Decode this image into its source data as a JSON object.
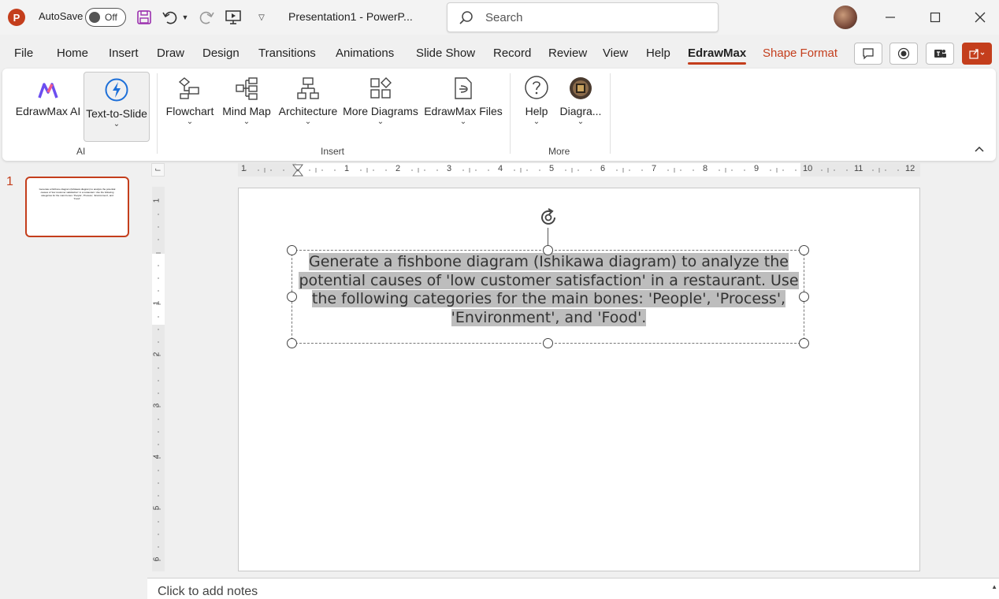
{
  "titlebar": {
    "autosave_label": "AutoSave",
    "autosave_state": "Off",
    "document_title": "Presentation1  -  PowerP...",
    "search_placeholder": "Search"
  },
  "tabs": [
    {
      "label": "File"
    },
    {
      "label": "Home"
    },
    {
      "label": "Insert"
    },
    {
      "label": "Draw"
    },
    {
      "label": "Design"
    },
    {
      "label": "Transitions"
    },
    {
      "label": "Animations"
    },
    {
      "label": "Slide Show"
    },
    {
      "label": "Record"
    },
    {
      "label": "Review"
    },
    {
      "label": "View"
    },
    {
      "label": "Help"
    },
    {
      "label": "EdrawMax",
      "active": true
    },
    {
      "label": "Shape Format",
      "contextual": true
    }
  ],
  "ribbon": {
    "groups": {
      "ai": "AI",
      "insert": "Insert",
      "more": "More"
    },
    "buttons": {
      "edrawmax_ai": "EdrawMax AI",
      "text_to_slide": "Text-to-Slide",
      "flowchart": "Flowchart",
      "mind_map": "Mind Map",
      "architecture": "Architecture",
      "more_diagrams": "More Diagrams",
      "edrawmax_files": "EdrawMax Files",
      "help": "Help",
      "diagra": "Diagra..."
    }
  },
  "slides_pane": {
    "slide_number": "1"
  },
  "ruler": {
    "h_numbers": [
      "1",
      "1",
      "2",
      "3",
      "4",
      "5",
      "6",
      "7",
      "8",
      "9",
      "10",
      "11",
      "12"
    ],
    "v_numbers": [
      "1",
      "1",
      "2",
      "3",
      "4",
      "5",
      "6"
    ]
  },
  "slide": {
    "text_lines": [
      "Generate a fishbone diagram (Ishikawa diagram) to analyze the",
      "potential causes of 'low customer satisfaction' in a restaurant. Use",
      "the following categories for the main bones: 'People', 'Process',",
      "'Environment', and 'Food'."
    ],
    "thumbnail_text": "Generate a fishbone diagram (Ishikawa diagram) to analyze the potential causes of 'low customer satisfaction' in a restaurant. Use the following categories for the main bones: 'People', 'Process', 'Environment', and 'Food'."
  },
  "notes": {
    "placeholder": "Click to add notes"
  },
  "colors": {
    "accent": "#c43e1c",
    "selection_highlight": "#bdbdbd"
  }
}
